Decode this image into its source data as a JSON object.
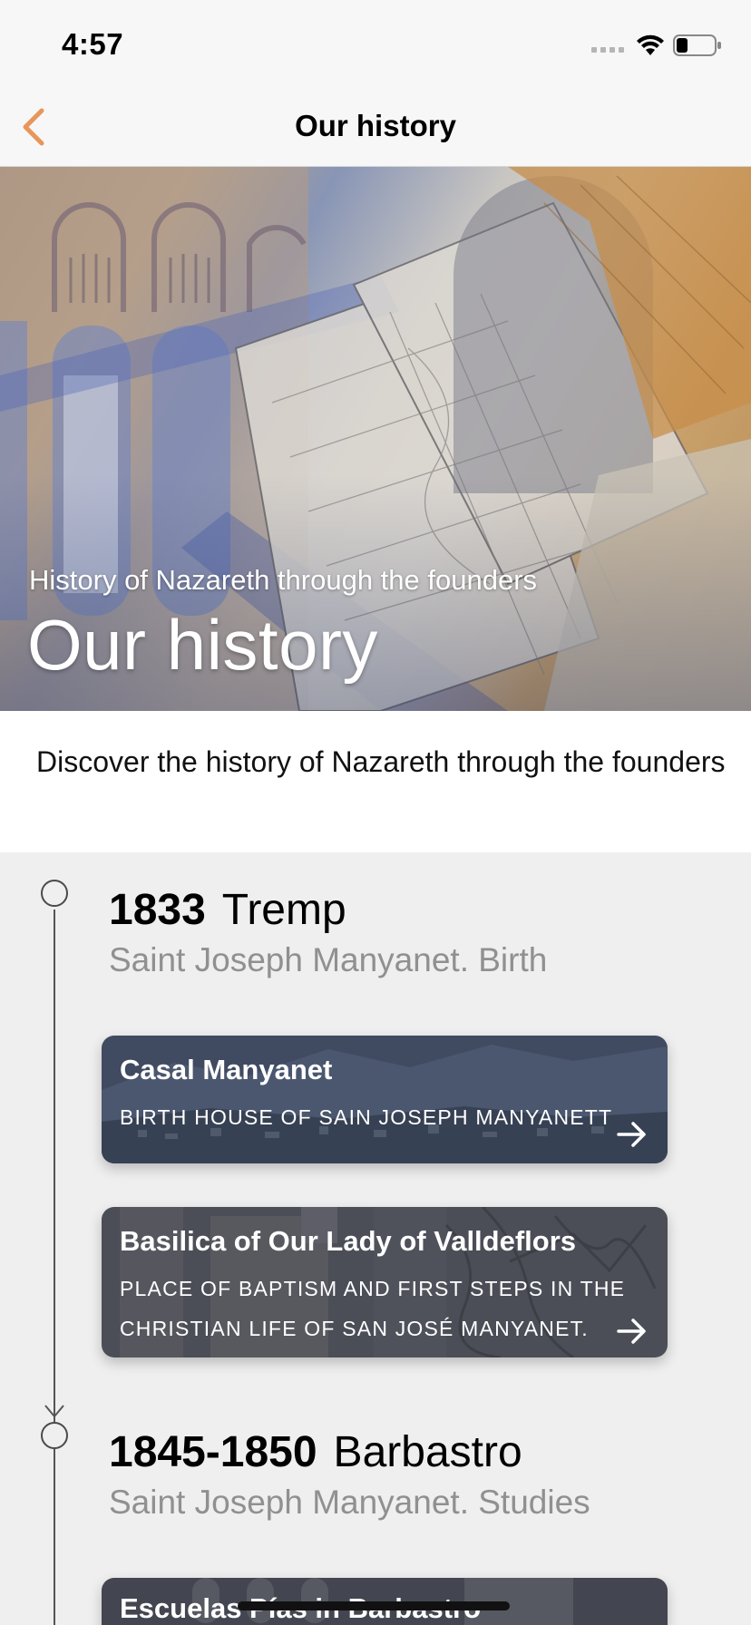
{
  "status_bar": {
    "time": "4:57"
  },
  "nav": {
    "title": "Our history"
  },
  "hero": {
    "subtitle": "History of Nazareth through the founders",
    "title": "Our history"
  },
  "description": "Discover the history of Nazareth through the founders",
  "timeline": [
    {
      "year": "1833",
      "place": "Tremp",
      "subtitle": "Saint Joseph Manyanet. Birth",
      "cards": [
        {
          "title": "Casal Manyanet",
          "description": "BIRTH HOUSE OF SAIN JOSEPH MANYANETT"
        },
        {
          "title": "Basilica of Our Lady of Valldeflors",
          "description": "PLACE OF BAPTISM AND FIRST STEPS IN THE CHRISTIAN LIFE OF SAN JOSÉ MANYANET."
        }
      ]
    },
    {
      "year": "1845-1850",
      "place": "Barbastro",
      "subtitle": "Saint Joseph Manyanet. Studies",
      "cards": [
        {
          "title": "Escuelas Pías in Barbastro"
        }
      ]
    }
  ],
  "colors": {
    "accent": "#e8965a",
    "background": "#efefef",
    "nav_background": "#f7f7f7",
    "subtitle_gray": "#909090"
  },
  "icons": {
    "back": "chevron-left-icon",
    "card_link": "arrow-right-icon",
    "timeline_node": "circle-outline-icon"
  }
}
